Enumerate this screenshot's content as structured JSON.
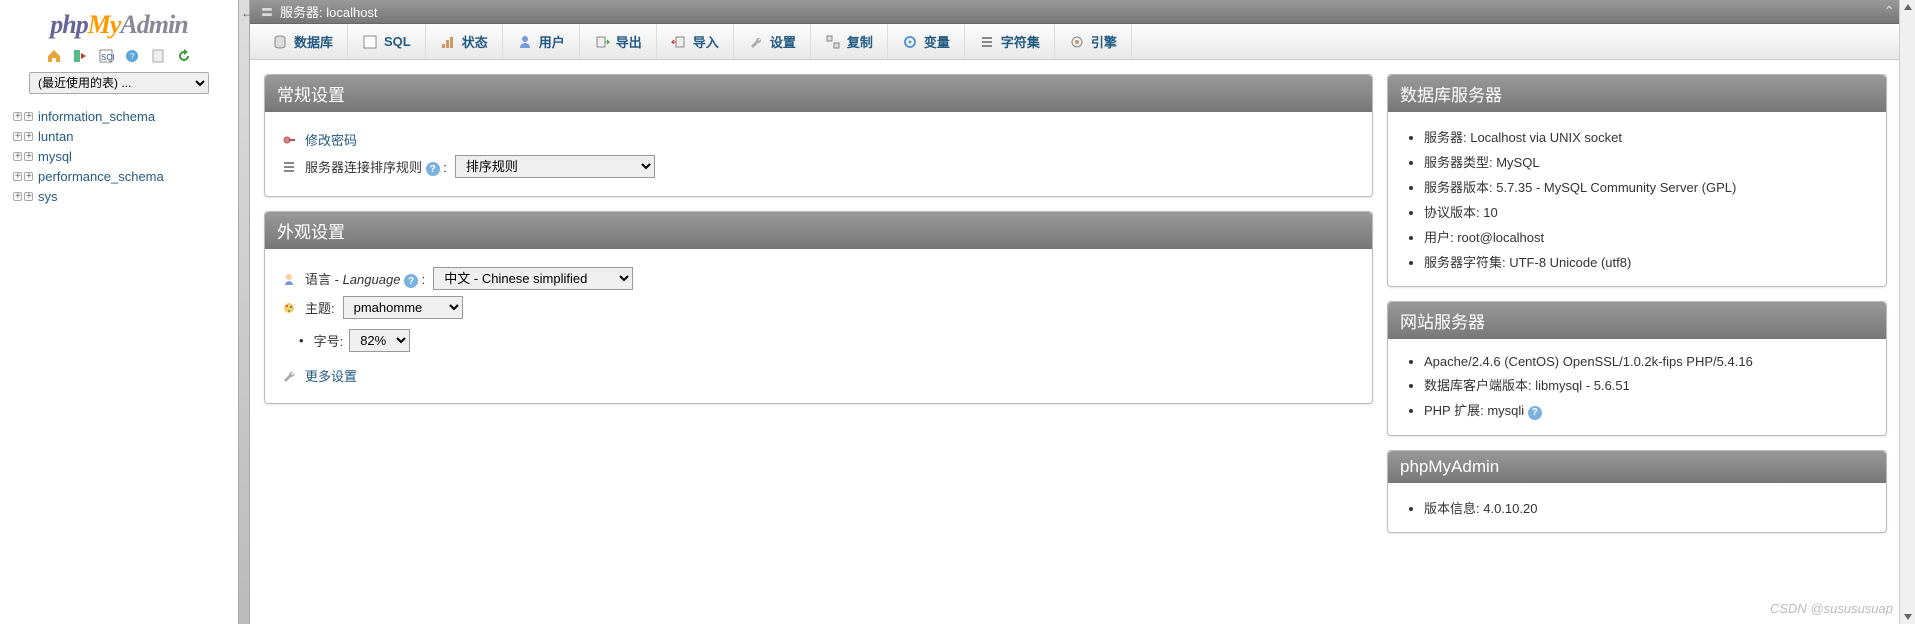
{
  "logo": {
    "php": "php",
    "my": "My",
    "admin": "Admin"
  },
  "recent_tables_placeholder": "(最近使用的表) ...",
  "databases": [
    "information_schema",
    "luntan",
    "mysql",
    "performance_schema",
    "sys"
  ],
  "breadcrumb": {
    "label": "服务器: localhost"
  },
  "tabs": [
    {
      "id": "databases",
      "label": "数据库"
    },
    {
      "id": "sql",
      "label": "SQL"
    },
    {
      "id": "status",
      "label": "状态"
    },
    {
      "id": "users",
      "label": "用户"
    },
    {
      "id": "export",
      "label": "导出"
    },
    {
      "id": "import",
      "label": "导入"
    },
    {
      "id": "settings",
      "label": "设置"
    },
    {
      "id": "replication",
      "label": "复制"
    },
    {
      "id": "variables",
      "label": "变量"
    },
    {
      "id": "charsets",
      "label": "字符集"
    },
    {
      "id": "engines",
      "label": "引擎"
    }
  ],
  "panels": {
    "general": {
      "title": "常规设置",
      "change_password": "修改密码",
      "collation_label": "服务器连接排序规则",
      "collation_value": "排序规则"
    },
    "appearance": {
      "title": "外观设置",
      "language_label": "语言",
      "language_en": "Language",
      "language_value": "中文 - Chinese simplified",
      "theme_label": "主题:",
      "theme_value": "pmahomme",
      "fontsize_label": "字号:",
      "fontsize_value": "82%",
      "more_settings": "更多设置"
    },
    "dbserver": {
      "title": "数据库服务器",
      "items": [
        "服务器: Localhost via UNIX socket",
        "服务器类型: MySQL",
        "服务器版本: 5.7.35 - MySQL Community Server (GPL)",
        "协议版本: 10",
        "用户: root@localhost",
        "服务器字符集: UTF-8 Unicode (utf8)"
      ]
    },
    "webserver": {
      "title": "网站服务器",
      "items_pre": [
        "Apache/2.4.6 (CentOS) OpenSSL/1.0.2k-fips PHP/5.4.16",
        "数据库客户端版本: libmysql - 5.6.51"
      ],
      "php_ext_label": "PHP 扩展: mysqli"
    },
    "pma": {
      "title": "phpMyAdmin",
      "version_label": "版本信息: 4.0.10.20"
    }
  },
  "watermark": "CSDN @susususuap"
}
